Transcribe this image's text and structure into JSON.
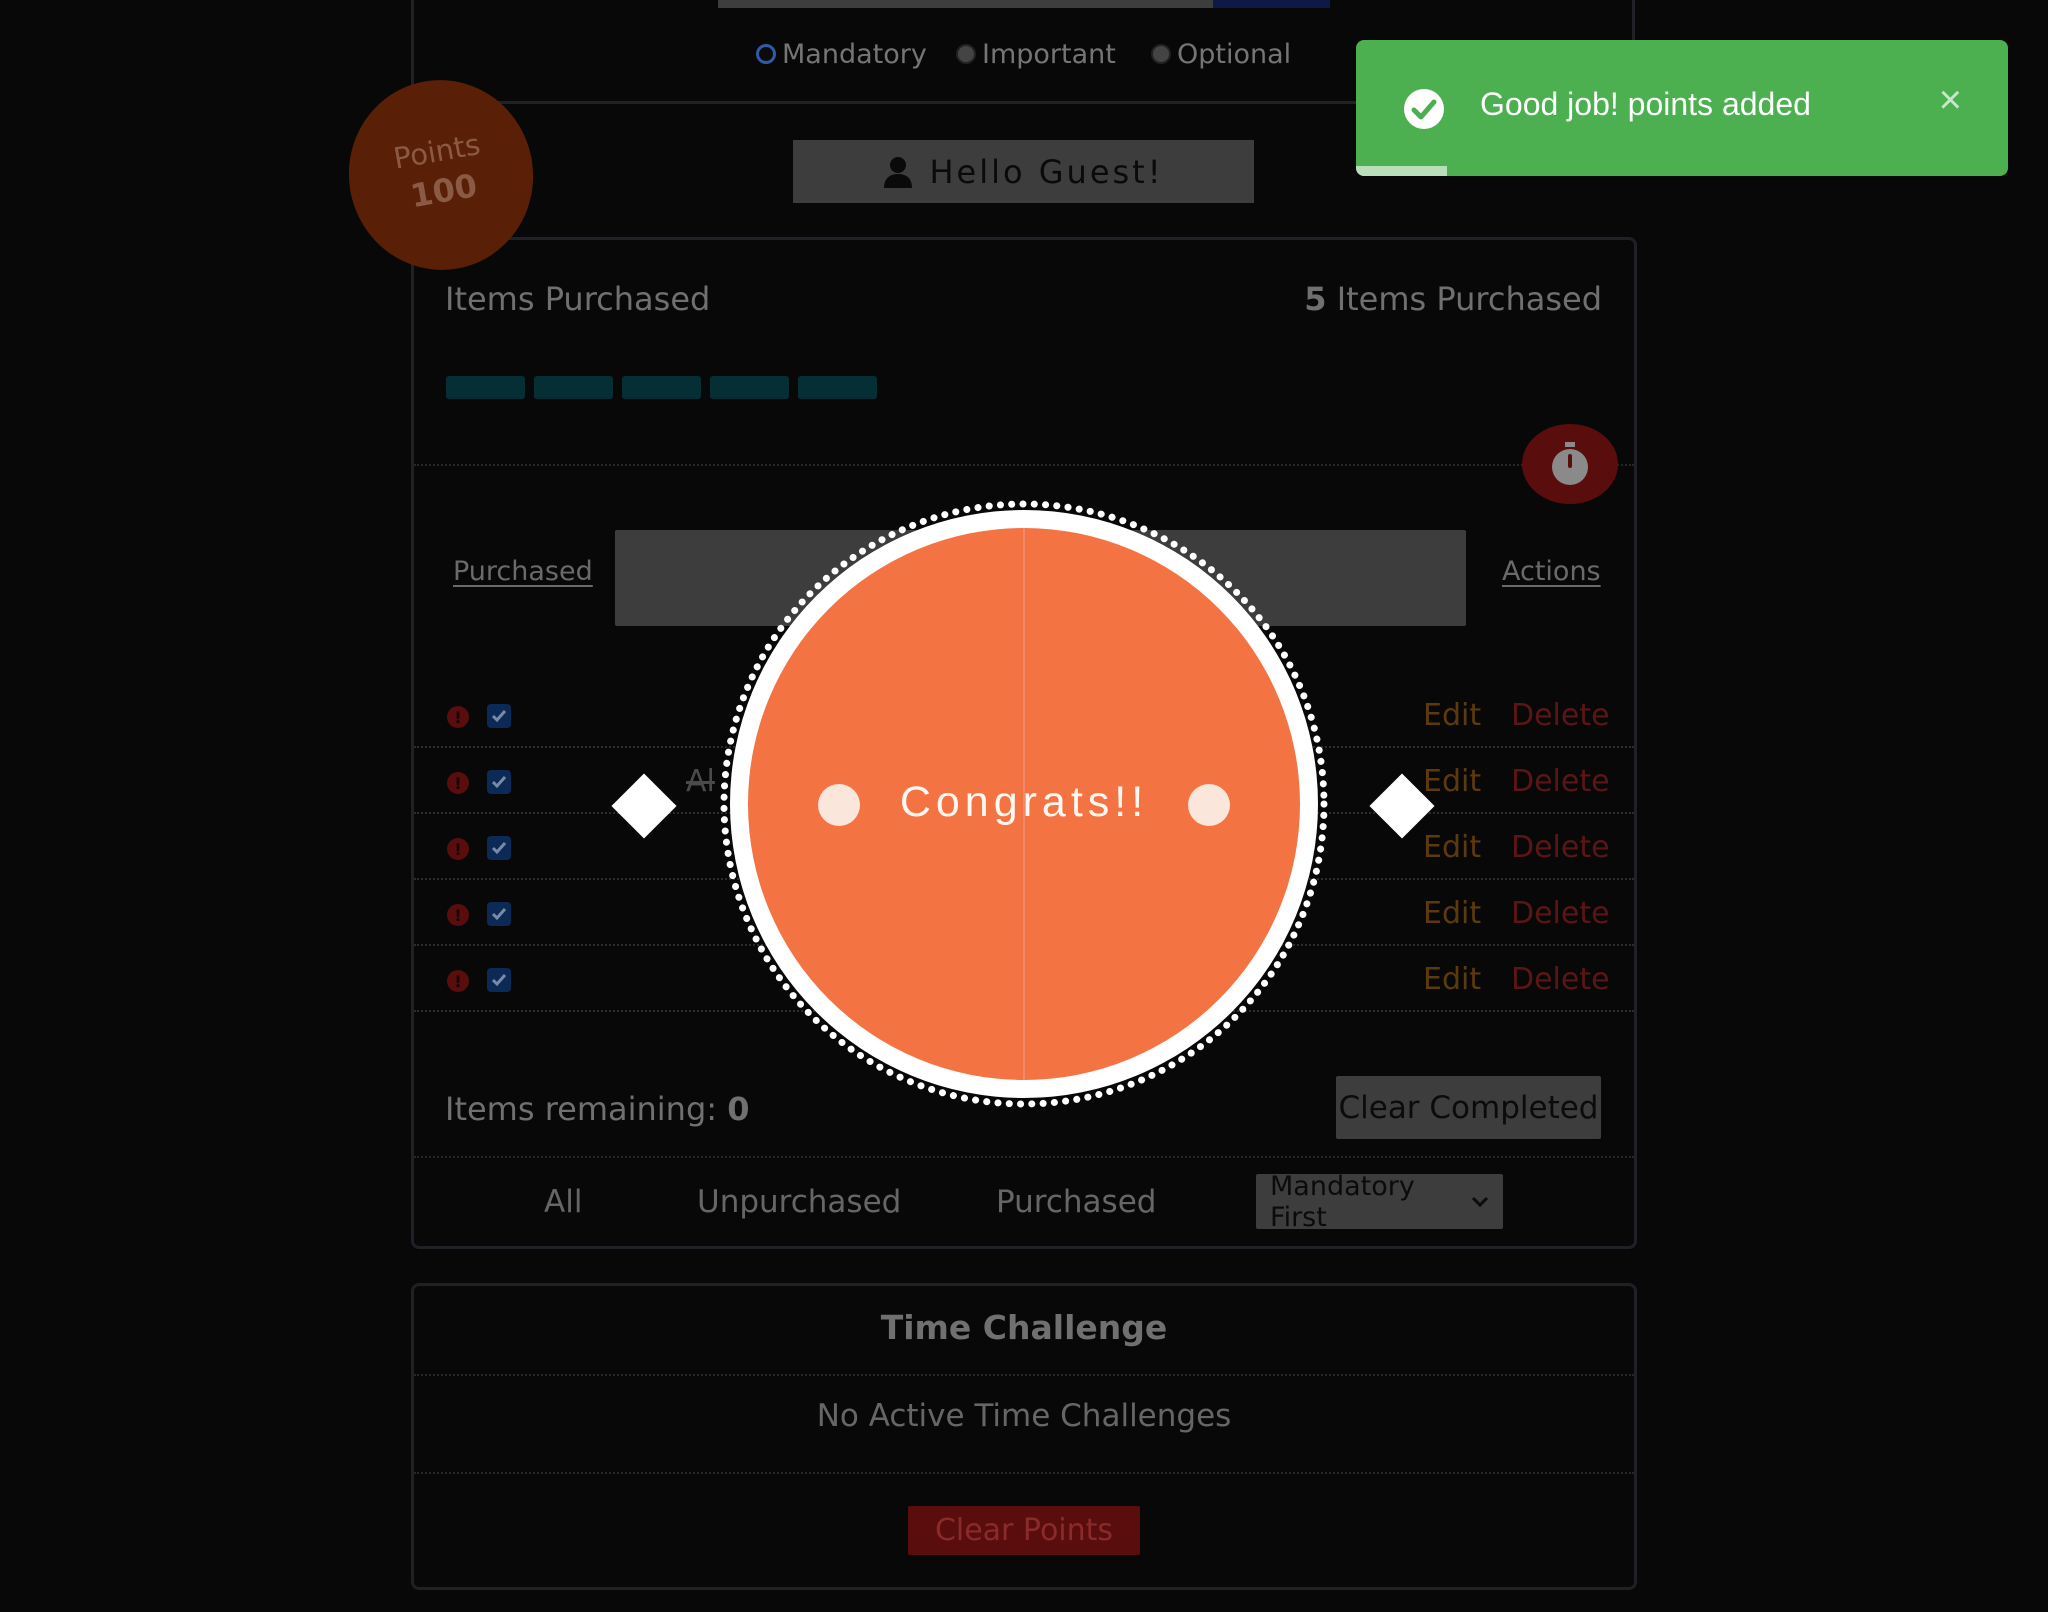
{
  "priority_radios": [
    {
      "label": "Mandatory",
      "selected": true
    },
    {
      "label": "Important",
      "selected": false
    },
    {
      "label": "Optional",
      "selected": false
    }
  ],
  "points_badge": {
    "label": "Points",
    "value": "100"
  },
  "greeting": {
    "text": "Hello Guest!",
    "icon": "user-icon"
  },
  "items_purchased": {
    "title": "Items Purchased",
    "count": "5",
    "count_suffix": " Items Purchased",
    "progress_segments": 5
  },
  "timer": {
    "icon": "stopwatch-icon"
  },
  "table": {
    "column_purchased": "Purchased",
    "column_actions": "Actions",
    "rows": [
      {
        "name": "",
        "checked": true,
        "edit_label": "Edit",
        "delete_label": "Delete"
      },
      {
        "name": "Al",
        "checked": true,
        "edit_label": "Edit",
        "delete_label": "Delete"
      },
      {
        "name": "",
        "checked": true,
        "edit_label": "Edit",
        "delete_label": "Delete"
      },
      {
        "name": "",
        "checked": true,
        "edit_label": "Edit",
        "delete_label": "Delete"
      },
      {
        "name": "",
        "checked": true,
        "edit_label": "Edit",
        "delete_label": "Delete"
      }
    ]
  },
  "remaining": {
    "label": "Items remaining: ",
    "value": "0"
  },
  "clear_completed_label": "Clear Completed",
  "filters": {
    "all": "All",
    "unpurchased": "Unpurchased",
    "purchased": "Purchased"
  },
  "sort_select": {
    "selected": "Mandatory First"
  },
  "time_challenge": {
    "title": "Time Challenge",
    "empty_text": "No Active Time Challenges",
    "clear_points_label": "Clear Points"
  },
  "toast": {
    "message": "Good job! points added",
    "close": "×",
    "progress": 0.14
  },
  "congrats": {
    "text": "Congrats!!"
  },
  "colors": {
    "toast_green": "#4caf50",
    "congrats_orange": "#f47342",
    "badge_brown": "#5a1f07"
  }
}
